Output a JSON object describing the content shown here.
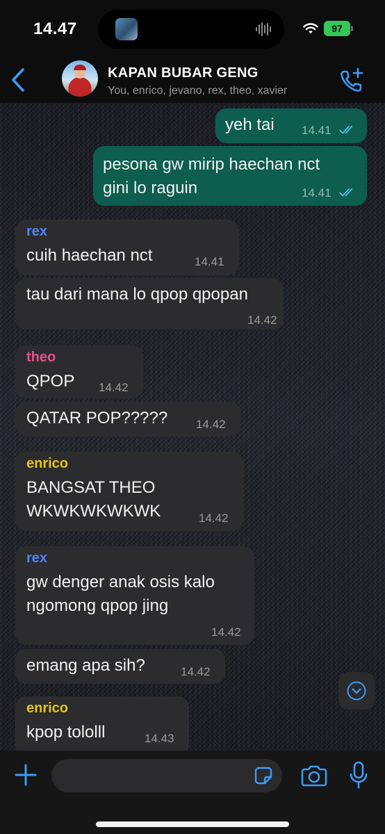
{
  "status_bar": {
    "time": "14.47",
    "battery": "97",
    "colors": {
      "battery": "#35c759"
    },
    "icons": [
      "media-thumbnail-icon",
      "sound-wave-icon",
      "wifi-icon",
      "battery-icon"
    ]
  },
  "header": {
    "group_name": "KAPAN BUBAR GENG",
    "members": "You, enrico, jevano, rex, theo, xavier",
    "icons": [
      "back-chevron-icon",
      "group-avatar",
      "add-call-icon"
    ],
    "colors": {
      "accent": "#3e9cf7"
    }
  },
  "messages": [
    {
      "direction": "outgoing",
      "text": [
        "yeh tai"
      ],
      "time": "14.41",
      "status": "read"
    },
    {
      "direction": "outgoing",
      "text": [
        "pesona gw mirip haechan nct",
        "gini lo raguin"
      ],
      "time": "14.41",
      "status": "read"
    },
    {
      "direction": "incoming",
      "sender": "rex",
      "text": [
        "cuih haechan nct"
      ],
      "time": "14.41"
    },
    {
      "direction": "incoming",
      "text": [
        "tau dari mana lo qpop qpopan"
      ],
      "time": "14.42"
    },
    {
      "direction": "incoming",
      "sender": "theo",
      "text": [
        "QPOP"
      ],
      "time": "14.42"
    },
    {
      "direction": "incoming",
      "text": [
        "QATAR POP?????"
      ],
      "time": "14.42"
    },
    {
      "direction": "incoming",
      "sender": "enrico",
      "text": [
        "BANGSAT THEO",
        "WKWKWKWKWK"
      ],
      "time": "14.42"
    },
    {
      "direction": "incoming",
      "sender": "rex",
      "text": [
        "gw denger anak osis kalo",
        "ngomong qpop jing"
      ],
      "time": "14.42"
    },
    {
      "direction": "incoming",
      "text": [
        "emang apa sih?"
      ],
      "time": "14.42"
    },
    {
      "direction": "incoming",
      "sender": "enrico",
      "text": [
        "kpop tololll"
      ],
      "time": "14.43"
    }
  ],
  "sender_colors": {
    "rex": "#4e84f2",
    "theo": "#e5528b",
    "enrico": "#e4c51c"
  },
  "bubble_colors": {
    "outgoing": "#0d5e4f",
    "incoming": "#2c2c2e",
    "read_ticks": "#53bdeb"
  },
  "composer": {
    "input_value": "",
    "icons": [
      "plus-icon",
      "sticker-icon",
      "camera-icon",
      "microphone-icon",
      "scroll-down-icon"
    ]
  }
}
